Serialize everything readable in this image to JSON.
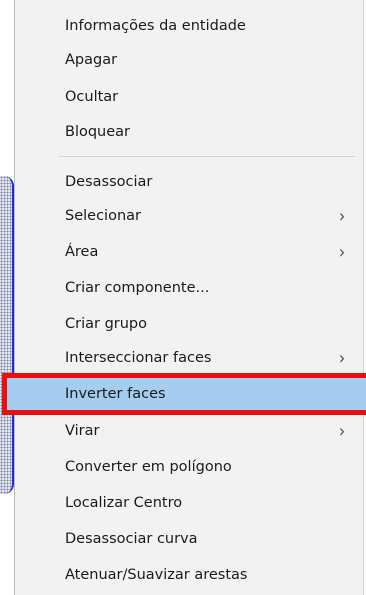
{
  "menu": {
    "items": [
      {
        "label": "Informações da entidade",
        "submenu": false
      },
      {
        "label": "Apagar",
        "submenu": false
      },
      {
        "label": "Ocultar",
        "submenu": false
      },
      {
        "label": "Bloquear",
        "submenu": false
      },
      {
        "label": "Desassociar",
        "submenu": false
      },
      {
        "label": "Selecionar",
        "submenu": true
      },
      {
        "label": "Área",
        "submenu": true
      },
      {
        "label": "Criar componente...",
        "submenu": false
      },
      {
        "label": "Criar grupo",
        "submenu": false
      },
      {
        "label": "Interseccionar faces",
        "submenu": true
      },
      {
        "label": "Inverter faces",
        "submenu": false,
        "highlighted": true
      },
      {
        "label": "Virar",
        "submenu": true
      },
      {
        "label": "Converter em polígono",
        "submenu": false
      },
      {
        "label": "Localizar Centro",
        "submenu": false
      },
      {
        "label": "Desassociar curva",
        "submenu": false
      },
      {
        "label": "Atenuar/Suavizar arestas",
        "submenu": false
      }
    ],
    "submenu_glyph": "›"
  },
  "colors": {
    "menu_background": "#f2f2f2",
    "highlight_background": "#a5cdf0",
    "highlight_outline": "#ee0d0d"
  }
}
